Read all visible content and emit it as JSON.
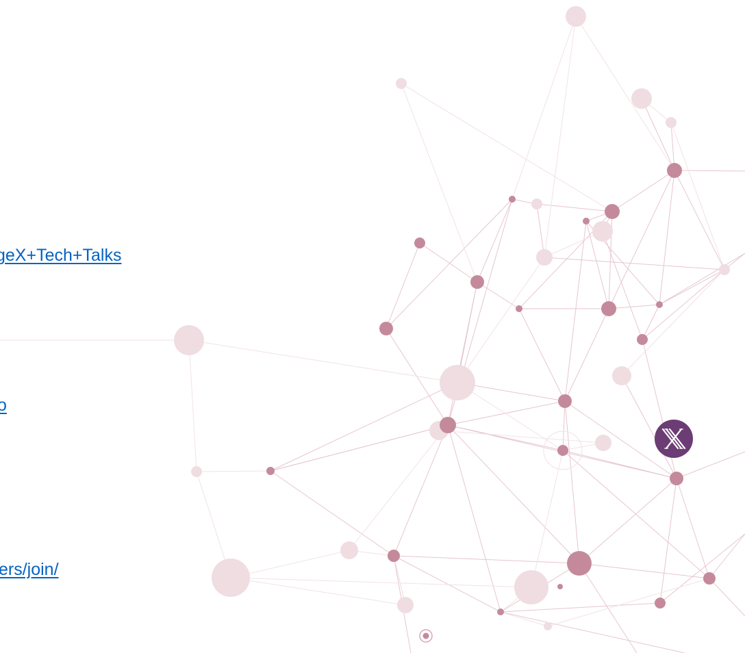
{
  "links": [
    {
      "text": "geX+Tech+Talks"
    },
    {
      "text": "o"
    },
    {
      "text": "ers/join/"
    }
  ],
  "logo": {
    "mark": "X",
    "color": "#6b3d74"
  },
  "colors": {
    "link": "#0563c1",
    "node_strong": "#c48a9c",
    "node_faint": "#efdde2",
    "edge": "#e7c9d2"
  }
}
